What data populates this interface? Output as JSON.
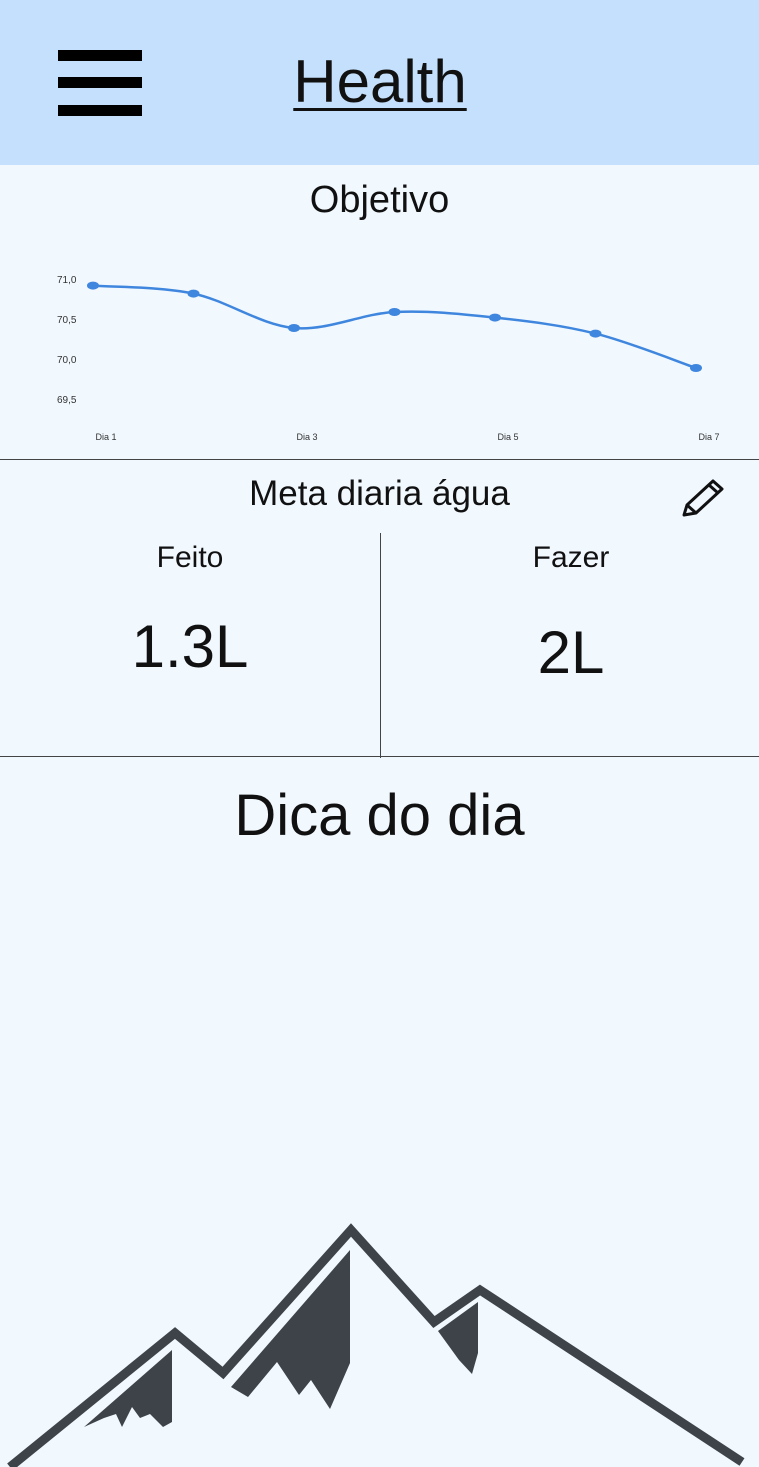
{
  "app_bar": {
    "title": "Health",
    "menu_icon": "hamburger-menu-icon",
    "background": "#c4e0fc"
  },
  "chart_section": {
    "title": "Objetivo"
  },
  "chart_data": {
    "type": "line",
    "title": "Objetivo",
    "x": [
      1,
      2,
      3,
      4,
      5,
      6,
      7
    ],
    "x_tick_labels": [
      "Dia 1",
      "Dia 3",
      "Dia 5",
      "Dia 7"
    ],
    "y_tick_labels": [
      "71,0",
      "70,5",
      "70,0",
      "69,5"
    ],
    "ylim": [
      69.5,
      71.0
    ],
    "series": [
      {
        "values": [
          70.93,
          70.83,
          70.4,
          70.6,
          70.53,
          70.33,
          69.9
        ]
      }
    ],
    "line_color": "#3f86de",
    "grid": false
  },
  "water_section": {
    "title": "Meta diaria água",
    "edit_icon": "pencil-icon",
    "done": {
      "label": "Feito",
      "value": "1.3L"
    },
    "todo": {
      "label": "Fazer",
      "value": "2L"
    }
  },
  "tip_section": {
    "title": "Dica do dia",
    "illustration": "mountain-icon",
    "illustration_color": "#3d4348"
  }
}
